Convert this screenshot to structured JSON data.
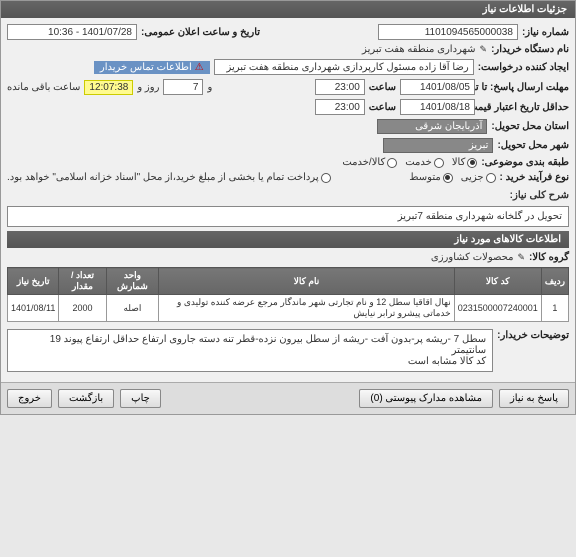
{
  "header": {
    "title": "جزئیات اطلاعات نیاز"
  },
  "fields": {
    "need_no_label": "شماره نیاز:",
    "need_no": "1101094565000038",
    "announce_label": "تاریخ و ساعت اعلان عمومی:",
    "announce": "1401/07/28 - 10:36",
    "buyer_label": "نام دستگاه خریدار:",
    "buyer": "شهرداری منطقه هفت تبریز",
    "creator_label": "ایجاد کننده درخواست:",
    "creator": "رضا آقا زاده مسئول کارپردازی شهرداری منطقه هفت تبریز",
    "contact_badge": "اطلاعات تماس خریدار",
    "deadline_label": "مهلت ارسال پاسخ: تا تاریخ:",
    "deadline_date": "1401/08/05",
    "time_label": "ساعت",
    "deadline_time": "23:00",
    "days_and": "و",
    "days_val": "7",
    "days_suffix": "روز و",
    "countdown": "12:07:38",
    "remaining": "ساعت باقی مانده",
    "validity_label": "حداقل تاریخ اعتبار قیمت: تا تاریخ:",
    "validity_date": "1401/08/18",
    "validity_time": "23:00",
    "province_label": "استان محل تحویل:",
    "province": "آذربایجان شرقی",
    "city_label": "شهر محل تحویل:",
    "city": "تبریز",
    "category_label": "طبقه بندی موضوعی:",
    "cat_goods": "کالا",
    "cat_service": "خدمت",
    "cat_both": "کالا/خدمت",
    "purchase_type_label": "نوع فرآیند خرید :",
    "pt_small": "جزیی",
    "pt_medium": "متوسط",
    "pt_note": "پرداخت تمام یا بخشی از مبلغ خرید،از محل \"اسناد خزانه اسلامی\" خواهد بود.",
    "desc_label": "شرح کلی نیاز:",
    "desc": "تحویل در گلخانه شهرداری منطقه 7تبریز",
    "items_header": "اطلاعات کالاهای مورد نیاز",
    "group_label": "گروه کالا:",
    "group": "محصولات کشاورزی",
    "buyer_notes_label": "توضیحات خریدار:",
    "buyer_notes_l1": "سطل 7 -ریشه پر-بدون آفت -ریشه از سطل بیرون نزده-قطر تنه دسته جاروی ارتفاع حداقل ارتفاع پیوند 19 سانتیمتر",
    "buyer_notes_l2": "کد کالا مشابه است"
  },
  "table": {
    "headers": {
      "row": "ردیف",
      "code": "کد کالا",
      "name": "نام کالا",
      "unit": "واحد شمارش",
      "qty": "تعداد / مقدار",
      "need_date": "تاریخ نیاز"
    },
    "rows": [
      {
        "idx": "1",
        "code": "0231500007240001",
        "name": "نهال اقاقیا سطل 12 و نام تجارتی شهر ماندگار مرجع عرضه کننده تولیدی و خدماتی پیشرو ترابر نیایش",
        "unit": "اصله",
        "qty": "2000",
        "need_date": "1401/08/11"
      }
    ]
  },
  "buttons": {
    "respond": "پاسخ به نیاز",
    "attachments": "مشاهده مدارک پیوستی (0)",
    "print": "چاپ",
    "back": "بازگشت",
    "exit": "خروج"
  }
}
